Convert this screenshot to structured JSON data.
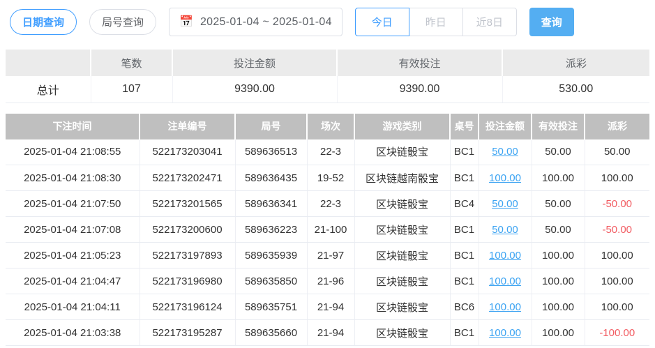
{
  "toolbar": {
    "date_query_label": "日期查询",
    "round_query_label": "局号查询",
    "date_range": "2025-01-04 ~ 2025-01-04",
    "today_label": "今日",
    "yesterday_label": "昨日",
    "last8_label": "近8日",
    "search_label": "查询"
  },
  "summary": {
    "headers": {
      "count": "笔数",
      "bet_amount": "投注金额",
      "valid_bet": "有效投注",
      "payout": "派彩"
    },
    "row_label": "总计",
    "count": "107",
    "bet_amount": "9390.00",
    "valid_bet": "9390.00",
    "payout": "530.00"
  },
  "table": {
    "headers": {
      "time": "下注时间",
      "order_no": "注单编号",
      "round_no": "局号",
      "session": "场次",
      "game": "游戏类别",
      "table_no": "桌号",
      "bet_amount": "投注金额",
      "valid_bet": "有效投注",
      "payout": "派彩"
    },
    "rows": [
      {
        "time": "2025-01-04 21:08:55",
        "order_no": "522173203041",
        "round_no": "589636513",
        "session": "22-3",
        "game": "区块链骰宝",
        "table_no": "BC1",
        "bet_amount": "50.00",
        "valid_bet": "50.00",
        "payout": "50.00"
      },
      {
        "time": "2025-01-04 21:08:30",
        "order_no": "522173202471",
        "round_no": "589636435",
        "session": "19-52",
        "game": "区块链越南骰宝",
        "table_no": "BC1",
        "bet_amount": "100.00",
        "valid_bet": "100.00",
        "payout": "100.00"
      },
      {
        "time": "2025-01-04 21:07:50",
        "order_no": "522173201565",
        "round_no": "589636341",
        "session": "22-3",
        "game": "区块链骰宝",
        "table_no": "BC4",
        "bet_amount": "50.00",
        "valid_bet": "50.00",
        "payout": "-50.00"
      },
      {
        "time": "2025-01-04 21:07:08",
        "order_no": "522173200600",
        "round_no": "589636223",
        "session": "21-100",
        "game": "区块链骰宝",
        "table_no": "BC1",
        "bet_amount": "50.00",
        "valid_bet": "50.00",
        "payout": "-50.00"
      },
      {
        "time": "2025-01-04 21:05:23",
        "order_no": "522173197893",
        "round_no": "589635939",
        "session": "21-97",
        "game": "区块链骰宝",
        "table_no": "BC1",
        "bet_amount": "100.00",
        "valid_bet": "100.00",
        "payout": "100.00"
      },
      {
        "time": "2025-01-04 21:04:47",
        "order_no": "522173196980",
        "round_no": "589635850",
        "session": "21-96",
        "game": "区块链骰宝",
        "table_no": "BC1",
        "bet_amount": "100.00",
        "valid_bet": "100.00",
        "payout": "100.00"
      },
      {
        "time": "2025-01-04 21:04:11",
        "order_no": "522173196124",
        "round_no": "589635751",
        "session": "21-94",
        "game": "区块链骰宝",
        "table_no": "BC6",
        "bet_amount": "100.00",
        "valid_bet": "100.00",
        "payout": "100.00"
      },
      {
        "time": "2025-01-04 21:03:38",
        "order_no": "522173195287",
        "round_no": "589635660",
        "session": "21-94",
        "game": "区块链骰宝",
        "table_no": "BC1",
        "bet_amount": "100.00",
        "valid_bet": "100.00",
        "payout": "-100.00"
      }
    ]
  },
  "colors": {
    "accent_blue": "#409eff",
    "search_button_blue": "#54aef2",
    "link_blue": "#3ba3f2",
    "negative_red": "#f25d63",
    "table_header_bg": "#bfbfbf",
    "summary_header_bg": "#ebebeb"
  }
}
